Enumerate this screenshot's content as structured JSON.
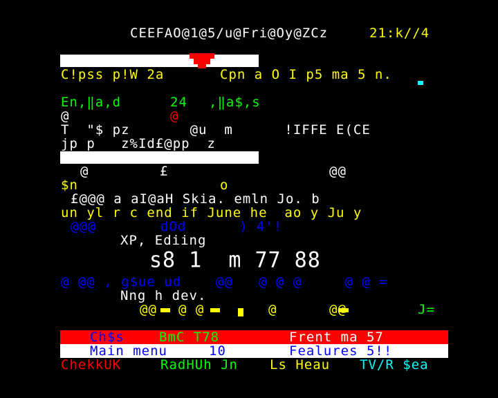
{
  "header": {
    "page_line": "CEEFAO@1@5/u@Fri@Oy@ZCz",
    "clock": "21:k//4"
  },
  "rows": {
    "r1": "C!pss p!W 2a",
    "r1b": "Cpn a O I p5 ma 5 n.",
    "r2a": "En,‖a,d",
    "r2b": "24",
    "r2c": ",‖a$,s",
    "r3a": "@",
    "r3b": "@",
    "r4": "T  \"$ pz       @u  m      !IFFE E(CE",
    "r5": "jp p   z%Id£@pp  z",
    "r6a": "@",
    "r6b": "£",
    "r6c": "@@",
    "r7a": "$n",
    "r7b": "o",
    "r8": "£@@@ a aI@aH Skia. emln Jo. b",
    "r9": "un yl r c end if June he  ao y Ju y",
    "r10a": "@@@",
    "r10b": "dOd",
    "r10c": ") 4'!",
    "r11": "XP, Ediing",
    "r12": "s8 1  m 77 88",
    "r13": "@ @@ , g$ue ud    @@   @ @ @     @ @ =",
    "r14": "Nng h dev.",
    "r15a": "@@",
    "r15b": "@ @",
    "r15c": "@",
    "r15d": "@@",
    "r15e": "J="
  },
  "fastext": {
    "red_bar_left": "Ch$s",
    "red_bar_mid": "BmC T78",
    "red_bar_right": "Frent ma 57",
    "main_menu": "Main menu",
    "main_menu_num": "10",
    "features": "Fealures 5!!",
    "link_red": "ChekkUK",
    "link_green": "RadHUh Jn",
    "link_yellow": "Ls Heau",
    "link_cyan": "TV/R $ea"
  },
  "colors": {
    "red": "#ff0000",
    "green": "#00ff00",
    "yellow": "#ffff00",
    "blue": "#0000ff",
    "cyan": "#00ffff",
    "white": "#ffffff"
  }
}
